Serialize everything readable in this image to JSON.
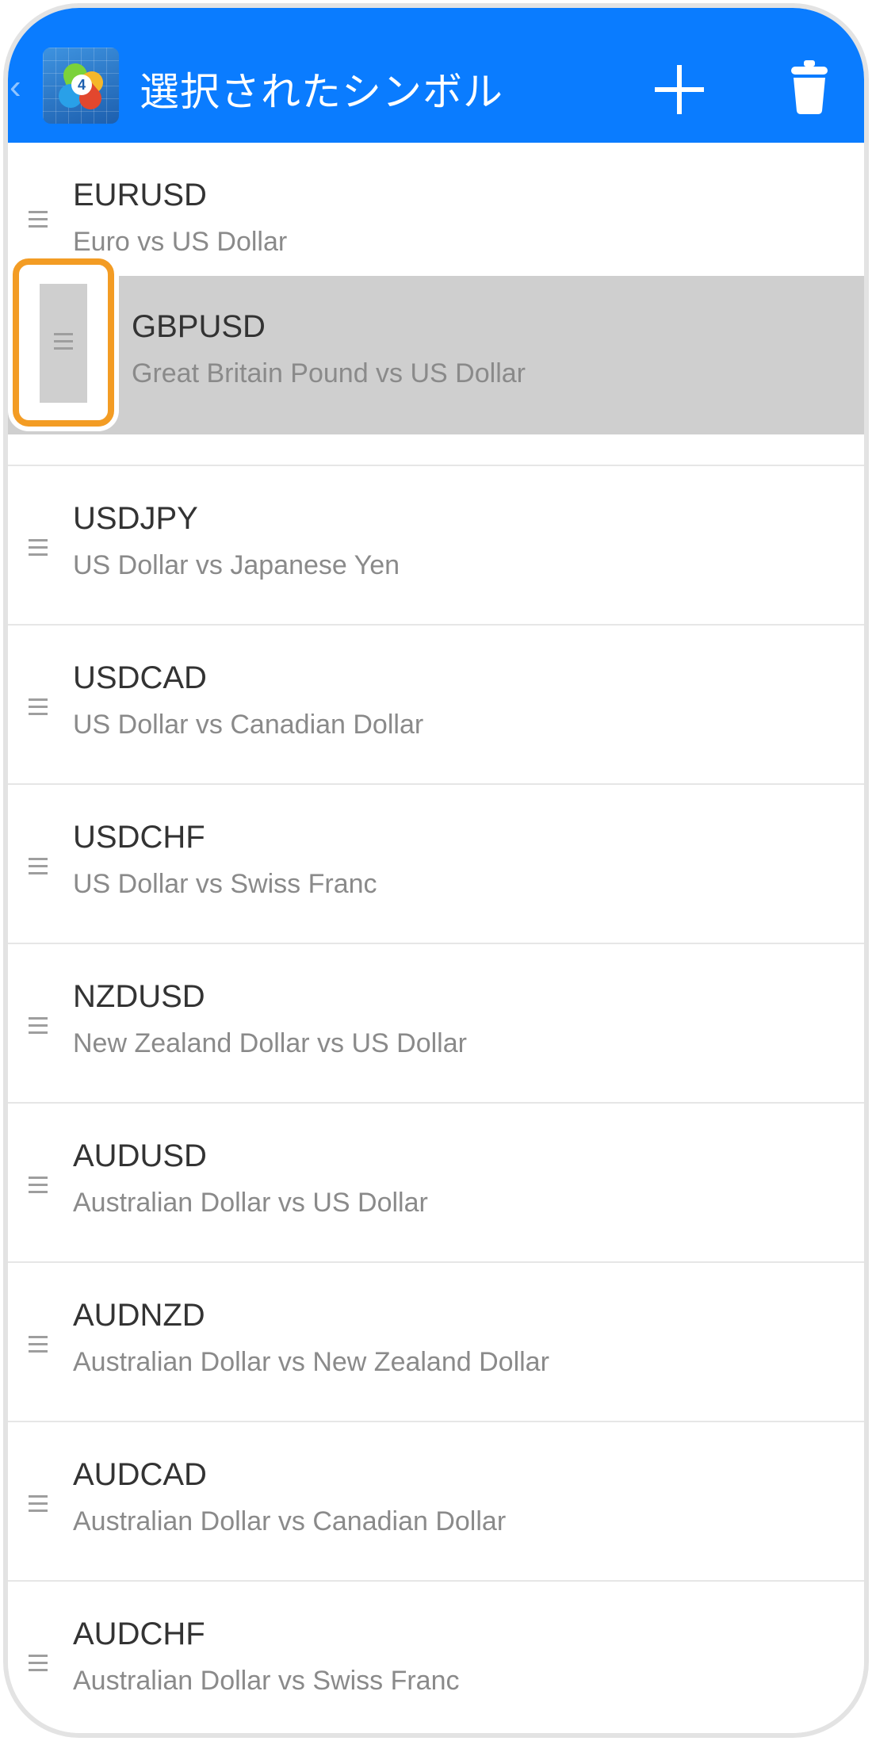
{
  "header": {
    "title": "選択されたシンボル",
    "back_glyph": "‹",
    "logo_badge": "4",
    "background_color": "#0a7cff",
    "add_icon": "plus-icon",
    "delete_icon": "trash-icon"
  },
  "highlight_color": "#f39c24",
  "symbols": [
    {
      "symbol": "EURUSD",
      "description": "Euro vs US Dollar"
    },
    {
      "symbol": "GBPUSD",
      "description": "Great Britain Pound vs US Dollar"
    },
    {
      "symbol": "USDJPY",
      "description": "US Dollar vs Japanese Yen"
    },
    {
      "symbol": "USDCAD",
      "description": "US Dollar vs Canadian Dollar"
    },
    {
      "symbol": "USDCHF",
      "description": "US Dollar vs Swiss Franc"
    },
    {
      "symbol": "NZDUSD",
      "description": "New Zealand Dollar vs US Dollar"
    },
    {
      "symbol": "AUDUSD",
      "description": "Australian Dollar vs US Dollar"
    },
    {
      "symbol": "AUDNZD",
      "description": "Australian Dollar vs New Zealand Dollar"
    },
    {
      "symbol": "AUDCAD",
      "description": "Australian Dollar vs Canadian Dollar"
    },
    {
      "symbol": "AUDCHF",
      "description": "Australian Dollar vs Swiss Franc"
    }
  ]
}
